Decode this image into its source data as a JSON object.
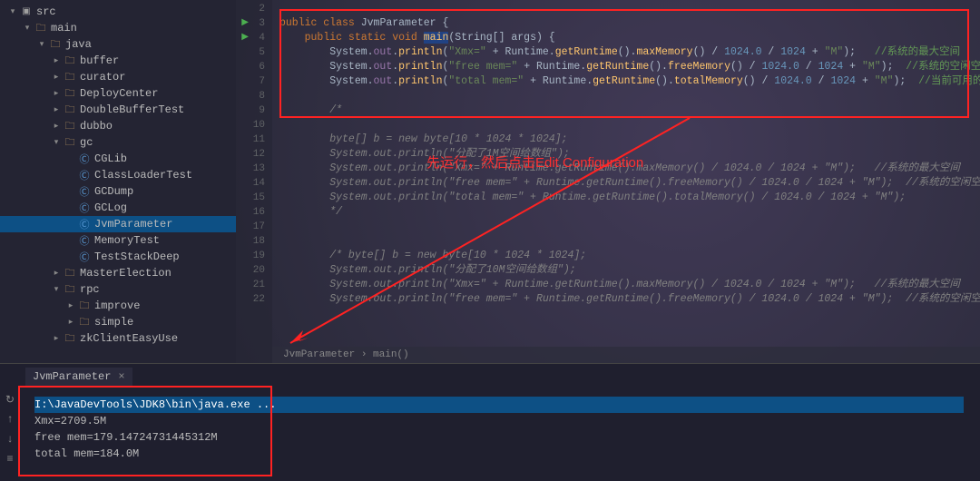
{
  "sidebar": {
    "nodes": [
      {
        "depth": 0,
        "arrow": "down",
        "icon": "pkg",
        "label": "src"
      },
      {
        "depth": 1,
        "arrow": "down",
        "icon": "folder",
        "label": "main"
      },
      {
        "depth": 2,
        "arrow": "down",
        "icon": "folder",
        "label": "java"
      },
      {
        "depth": 3,
        "arrow": "right",
        "icon": "folder",
        "label": "buffer"
      },
      {
        "depth": 3,
        "arrow": "right",
        "icon": "folder",
        "label": "curator"
      },
      {
        "depth": 3,
        "arrow": "right",
        "icon": "folder",
        "label": "DeployCenter"
      },
      {
        "depth": 3,
        "arrow": "right",
        "icon": "folder",
        "label": "DoubleBufferTest"
      },
      {
        "depth": 3,
        "arrow": "right",
        "icon": "folder",
        "label": "dubbo"
      },
      {
        "depth": 3,
        "arrow": "down",
        "icon": "folder",
        "label": "gc"
      },
      {
        "depth": 4,
        "arrow": "",
        "icon": "class",
        "label": "CGLib"
      },
      {
        "depth": 4,
        "arrow": "",
        "icon": "class",
        "label": "ClassLoaderTest"
      },
      {
        "depth": 4,
        "arrow": "",
        "icon": "class",
        "label": "GCDump"
      },
      {
        "depth": 4,
        "arrow": "",
        "icon": "class",
        "label": "GCLog"
      },
      {
        "depth": 4,
        "arrow": "",
        "icon": "class",
        "label": "JvmParameter",
        "selected": true
      },
      {
        "depth": 4,
        "arrow": "",
        "icon": "class",
        "label": "MemoryTest"
      },
      {
        "depth": 4,
        "arrow": "",
        "icon": "class",
        "label": "TestStackDeep"
      },
      {
        "depth": 3,
        "arrow": "right",
        "icon": "folder",
        "label": "MasterElection"
      },
      {
        "depth": 3,
        "arrow": "down",
        "icon": "folder",
        "label": "rpc"
      },
      {
        "depth": 4,
        "arrow": "right",
        "icon": "folder",
        "label": "improve"
      },
      {
        "depth": 4,
        "arrow": "right",
        "icon": "folder",
        "label": "simple"
      },
      {
        "depth": 3,
        "arrow": "right",
        "icon": "folder",
        "label": "zkClientEasyUse"
      }
    ]
  },
  "editor": {
    "first_line_number": 2,
    "lines": [
      {
        "n": 2,
        "html": ""
      },
      {
        "n": 3,
        "run": true,
        "html": "<span class='kw'>public class</span> <span class='cls'>JvmParameter</span> {"
      },
      {
        "n": 4,
        "run": true,
        "html": "    <span class='kw'>public static void</span> <span class='mth highlight-sel'>main</span>(String[] args) {"
      },
      {
        "n": 5,
        "html": "        System.<span class='fld'>out</span>.<span class='mth'>println</span>(<span class='str'>\"Xmx=\"</span> + Runtime.<span class='mth'>getRuntime</span>().<span class='mth'>maxMemory</span>() / <span class='num'>1024.0</span> / <span class='num'>1024</span> + <span class='str'>\"M\"</span>);   <span class='cmt-hi'>//系统的最大空间</span>"
      },
      {
        "n": 6,
        "html": "        System.<span class='fld'>out</span>.<span class='mth'>println</span>(<span class='str'>\"free mem=\"</span> + Runtime.<span class='mth'>getRuntime</span>().<span class='mth'>freeMemory</span>() / <span class='num'>1024.0</span> / <span class='num'>1024</span> + <span class='str'>\"M\"</span>);  <span class='cmt-hi'>//系统的空闲空间</span>"
      },
      {
        "n": 7,
        "html": "        System.<span class='fld'>out</span>.<span class='mth'>println</span>(<span class='str'>\"total mem=\"</span> + Runtime.<span class='mth'>getRuntime</span>().<span class='mth'>totalMemory</span>() / <span class='num'>1024.0</span> / <span class='num'>1024</span> + <span class='str'>\"M\"</span>);  <span class='cmt-hi'>//当前可用的总空间</span>"
      },
      {
        "n": 8,
        "html": ""
      },
      {
        "n": 9,
        "html": "        <span class='cmt'>/*</span>"
      },
      {
        "n": 10,
        "html": ""
      },
      {
        "n": 11,
        "html": "        <span class='cmt'>byte[] b = new byte[10 * 1024 * 1024];</span>"
      },
      {
        "n": 12,
        "html": "        <span class='cmt'>System.out.println(\"分配了1M空间给数组\");</span>"
      },
      {
        "n": 13,
        "html": "        <span class='cmt'>System.out.println(\"Xmx=\" + Runtime.getRuntime().maxMemory() / 1024.0 / 1024 + \"M\");   //系统的最大空间</span>"
      },
      {
        "n": 14,
        "html": "        <span class='cmt'>System.out.println(\"free mem=\" + Runtime.getRuntime().freeMemory() / 1024.0 / 1024 + \"M\");  //系统的空闲空间</span>"
      },
      {
        "n": 15,
        "html": "        <span class='cmt'>System.out.println(\"total mem=\" + Runtime.getRuntime().totalMemory() / 1024.0 / 1024 + \"M\");</span>"
      },
      {
        "n": 16,
        "html": "        <span class='cmt'>*/</span>"
      },
      {
        "n": 17,
        "html": ""
      },
      {
        "n": 18,
        "html": ""
      },
      {
        "n": 19,
        "html": "        <span class='cmt'>/* byte[] b = new byte[10 * 1024 * 1024];</span>"
      },
      {
        "n": 20,
        "html": "        <span class='cmt'>System.out.println(\"分配了10M空间给数组\");</span>"
      },
      {
        "n": 21,
        "html": "        <span class='cmt'>System.out.println(\"Xmx=\" + Runtime.getRuntime().maxMemory() / 1024.0 / 1024 + \"M\");   //系统的最大空间</span>"
      },
      {
        "n": 22,
        "html": "        <span class='cmt'>System.out.println(\"free mem=\" + Runtime.getRuntime().freeMemory() / 1024.0 / 1024 + \"M\");  //系统的空闲空间</span>"
      }
    ],
    "breadcrumb": "JvmParameter  ›  main()"
  },
  "annotation": "先运行，然后点击Edit Configuration",
  "run": {
    "tab_label": "JvmParameter",
    "lines": [
      {
        "text": "I:\\JavaDevTools\\JDK8\\bin\\java.exe ...",
        "selected": true
      },
      {
        "text": "Xmx=2709.5M"
      },
      {
        "text": "free mem=179.14724731445312M"
      },
      {
        "text": "total mem=184.0M"
      }
    ]
  }
}
